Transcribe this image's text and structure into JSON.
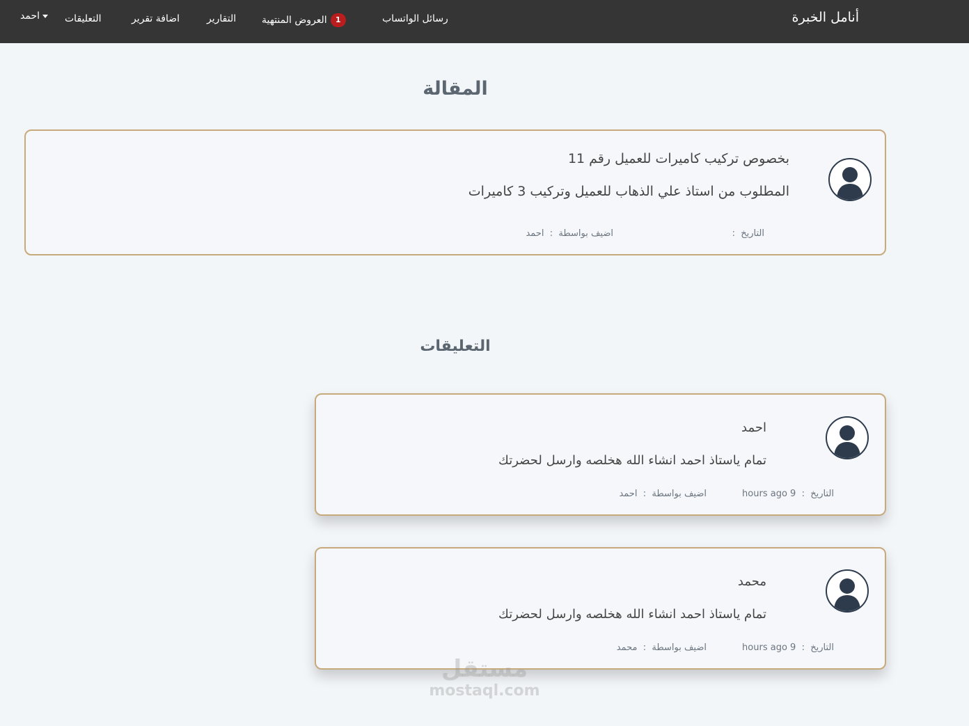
{
  "navbar": {
    "brand": "أنامل الخبرة",
    "links": [
      "رسائل الواتساب",
      "العروض المنتهية",
      "التقارير",
      "اضافة تقرير",
      "التعليقات"
    ],
    "expired_offers_badge": "1",
    "user": "احمد"
  },
  "article": {
    "section_title": "المقالة",
    "title": "بخصوص تركيب كاميرات للعميل رقم 11",
    "body": "المطلوب من استاذ علي الذهاب للعميل وتركيب 3 كاميرات",
    "date_label": "التاريخ",
    "date_value": "",
    "added_by_label": "اضيف بواسطة",
    "added_by": "احمد"
  },
  "comments_section": {
    "title": "التعليقات",
    "comments": [
      {
        "author": "احمد",
        "text": "تمام ياستاذ احمد انشاء الله هخلصه وارسل لحضرتك",
        "date_label": "التاريخ",
        "date_value": "9 hours ago",
        "added_by_label": "اضيف بواسطة",
        "added_by": "احمد"
      },
      {
        "author": "محمد",
        "text": "تمام ياستاذ احمد انشاء الله هخلصه وارسل لحضرتك",
        "date_label": "التاريخ",
        "date_value": "9 hours ago",
        "added_by_label": "اضيف بواسطة",
        "added_by": "محمد"
      }
    ]
  },
  "watermark": {
    "arabic": "مستقل",
    "latin": "mostaql.com"
  }
}
